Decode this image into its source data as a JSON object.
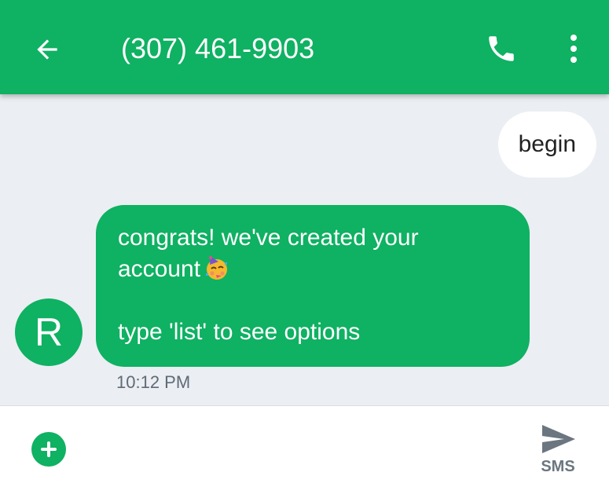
{
  "header": {
    "title": "(307) 461-9903",
    "back_icon": "arrow-left-icon",
    "call_icon": "phone-icon",
    "more_icon": "more-vertical-icon",
    "color": "#0fb162"
  },
  "thread": {
    "outgoing": [
      {
        "text": "begin"
      }
    ],
    "incoming": [
      {
        "avatar_letter": "R",
        "text": "congrats! we've created your\naccount",
        "text2": "\n\ntype 'list' to see options",
        "emoji": "partying-face-emoji",
        "timestamp": "10:12 PM"
      }
    ]
  },
  "compose": {
    "placeholder": "",
    "value": "",
    "add_icon": "plus-circle-icon",
    "send_icon": "send-icon",
    "send_label": "SMS"
  }
}
